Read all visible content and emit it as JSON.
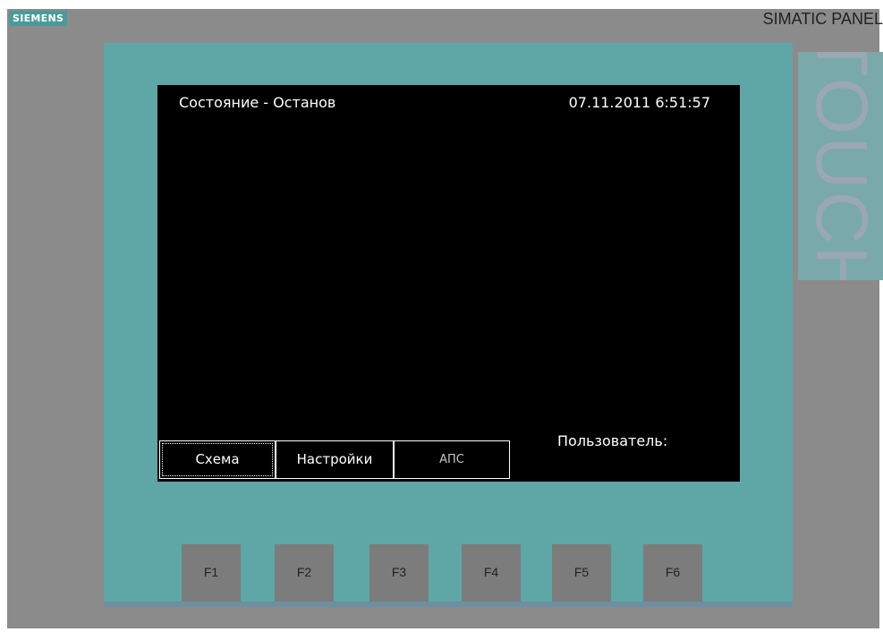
{
  "device": {
    "brand": "SIEMENS",
    "model": "SIMATIC PANEL",
    "series": "TOUCH"
  },
  "screen": {
    "status": "Состояние - Останов",
    "datetime": "07.11.2011 6:51:57",
    "user_label": "Пользователь:",
    "tabs": [
      {
        "label": "Схема"
      },
      {
        "label": "Настройки"
      },
      {
        "label": "АПС"
      }
    ]
  },
  "function_keys": [
    {
      "label": "F1"
    },
    {
      "label": "F2"
    },
    {
      "label": "F3"
    },
    {
      "label": "F4"
    },
    {
      "label": "F5"
    },
    {
      "label": "F6"
    }
  ],
  "colors": {
    "housing": "#8c8b8c",
    "bezel": "#5fa6a6",
    "screen_bg": "#000000",
    "screen_text": "#ffffff"
  }
}
